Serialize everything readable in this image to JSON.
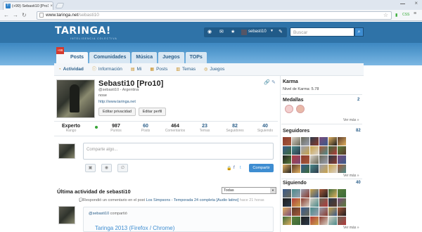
{
  "browser": {
    "tab_title": "(+99) Sebasti10 [Pro10] e",
    "tab_favicon": "T!",
    "url_host": "www.taringa.net",
    "url_path": "/sebasti10",
    "extension_label": "CSS"
  },
  "header": {
    "logo": "TARINGA!",
    "tagline": "INTELIGENCIA COLECTIVA",
    "username": "sebasti10",
    "search_placeholder": "Buscar",
    "accent_color": "#2f73a8"
  },
  "mainnav": {
    "badge": "+99",
    "items": [
      {
        "label": "Posts"
      },
      {
        "label": "Comunidades"
      },
      {
        "label": "Música"
      },
      {
        "label": "Juegos"
      },
      {
        "label": "TOPs"
      }
    ]
  },
  "subnav": {
    "items": [
      {
        "label": "Actividad",
        "icon": "activity-icon"
      },
      {
        "label": "Información",
        "icon": "info-icon"
      },
      {
        "label": "Mi",
        "icon": "me-icon"
      },
      {
        "label": "Posts",
        "icon": "posts-icon"
      },
      {
        "label": "Temas",
        "icon": "topics-icon"
      },
      {
        "label": "Juegos",
        "icon": "games-icon"
      }
    ]
  },
  "profile": {
    "name": "Sebasti10 [Pro10]",
    "handle_line": "@sebasti10 - Argentina",
    "bio": "nose",
    "website": "http://www.taringa.net",
    "edit_privacy_label": "Editar privacidad",
    "edit_profile_label": "Editar perfil"
  },
  "stats": [
    {
      "value": "Experto",
      "label": "Rango"
    },
    {
      "value": "987",
      "label": "Puntos"
    },
    {
      "value": "60",
      "label": "Posts"
    },
    {
      "value": "464",
      "label": "Comentarios"
    },
    {
      "value": "23",
      "label": "Temas"
    },
    {
      "value": "82",
      "label": "Seguidores"
    },
    {
      "value": "40",
      "label": "Siguiendo"
    }
  ],
  "composer": {
    "placeholder": "Comparte algo...",
    "submit_label": "Compartir"
  },
  "activity": {
    "title": "Última actividad de sebasti10",
    "filter": "Todas",
    "line_prefix": "Respondió un comentario en el post",
    "line_post": "Los Simpsons - Temporada 24 completa [Audio latino]",
    "line_time": "hace 21 horas",
    "card_user": "@sebasti10",
    "card_verb": "compartió",
    "card_title": "Taringa 2013 (Firefox / Chrome)"
  },
  "sidebar": {
    "karma_title": "Karma",
    "karma_level_label": "Nivel de Karma:",
    "karma_level_value": "5.78",
    "medals_title": "Medallas",
    "medals_count": "2",
    "more_label": "Ver más »",
    "followers_title": "Seguidores",
    "followers_count": "82",
    "following_title": "Siguiendo",
    "following_count": "40"
  }
}
